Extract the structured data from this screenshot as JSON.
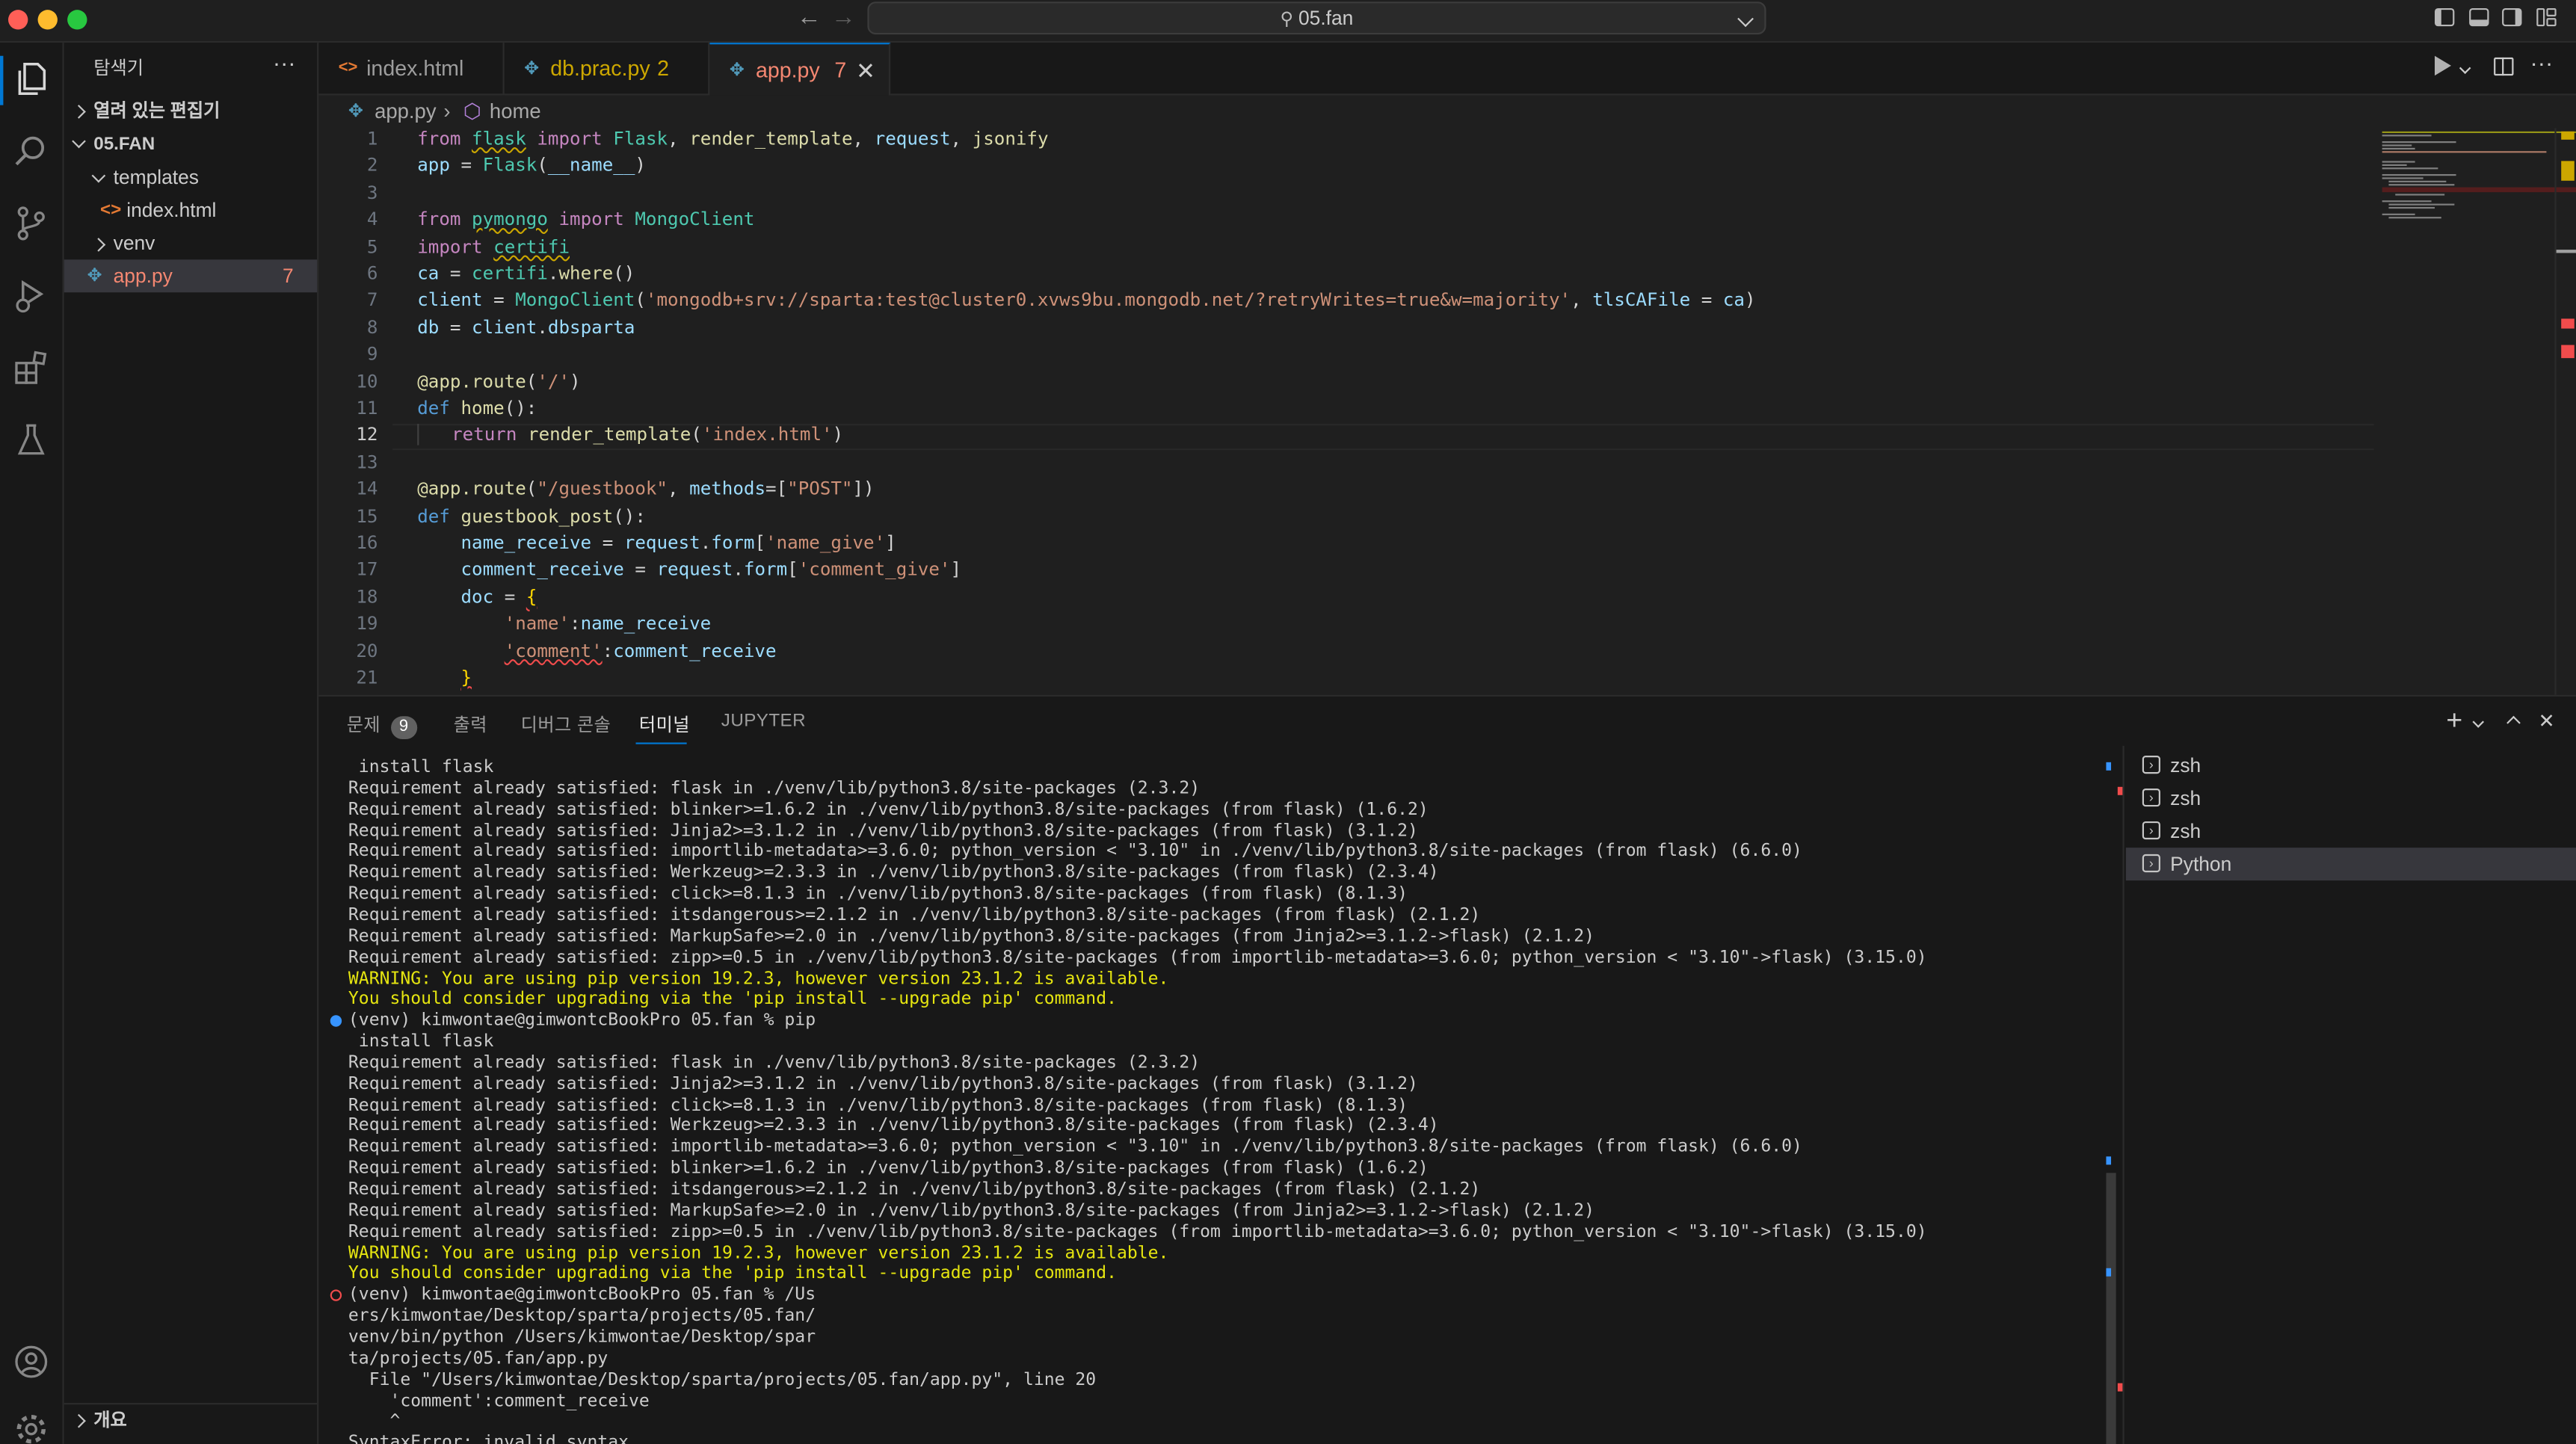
{
  "window": {
    "title": "05.fan"
  },
  "explorer": {
    "title": "탐색기",
    "open_editors": "열려 있는 편집기",
    "project": "05.FAN",
    "items": [
      {
        "label": "templates"
      },
      {
        "label": "index.html"
      },
      {
        "label": "venv"
      },
      {
        "label": "app.py",
        "badge": "7"
      }
    ],
    "outline": "개요"
  },
  "tabs": [
    {
      "label": "index.html",
      "badge": ""
    },
    {
      "label": "db.prac.py",
      "badge": "2"
    },
    {
      "label": "app.py",
      "badge": "7"
    }
  ],
  "breadcrumb": {
    "file": "app.py",
    "symbol": "home"
  },
  "editor": {
    "current_line": 12,
    "line_numbers": [
      "1",
      "2",
      "3",
      "4",
      "5",
      "6",
      "7",
      "8",
      "9",
      "10",
      "11",
      "12",
      "13",
      "14",
      "15",
      "16",
      "17",
      "18",
      "19",
      "20",
      "21"
    ]
  },
  "panel": {
    "tabs": [
      {
        "label": "문제",
        "badge": "9"
      },
      {
        "label": "출력"
      },
      {
        "label": "디버그 콘솔"
      },
      {
        "label": "터미널"
      },
      {
        "label": "JUPYTER"
      }
    ],
    "terminals": [
      "zsh",
      "zsh",
      "zsh",
      "Python"
    ]
  },
  "terminal_lines": [
    {
      "text": " install flask",
      "type": "normal"
    },
    {
      "text": "Requirement already satisfied: flask in ./venv/lib/python3.8/site-packages (2.3.2)",
      "type": "normal"
    },
    {
      "text": "Requirement already satisfied: blinker>=1.6.2 in ./venv/lib/python3.8/site-packages (from flask) (1.6.2)",
      "type": "normal"
    },
    {
      "text": "Requirement already satisfied: Jinja2>=3.1.2 in ./venv/lib/python3.8/site-packages (from flask) (3.1.2)",
      "type": "normal"
    },
    {
      "text": "Requirement already satisfied: importlib-metadata>=3.6.0; python_version < \"3.10\" in ./venv/lib/python3.8/site-packages (from flask) (6.6.0)",
      "type": "normal"
    },
    {
      "text": "Requirement already satisfied: Werkzeug>=2.3.3 in ./venv/lib/python3.8/site-packages (from flask) (2.3.4)",
      "type": "normal"
    },
    {
      "text": "Requirement already satisfied: click>=8.1.3 in ./venv/lib/python3.8/site-packages (from flask) (8.1.3)",
      "type": "normal"
    },
    {
      "text": "Requirement already satisfied: itsdangerous>=2.1.2 in ./venv/lib/python3.8/site-packages (from flask) (2.1.2)",
      "type": "normal"
    },
    {
      "text": "Requirement already satisfied: MarkupSafe>=2.0 in ./venv/lib/python3.8/site-packages (from Jinja2>=3.1.2->flask) (2.1.2)",
      "type": "normal"
    },
    {
      "text": "Requirement already satisfied: zipp>=0.5 in ./venv/lib/python3.8/site-packages (from importlib-metadata>=3.6.0; python_version < \"3.10\"->flask) (3.15.0)",
      "type": "normal"
    },
    {
      "text": "WARNING: You are using pip version 19.2.3, however version 23.1.2 is available.",
      "type": "warn"
    },
    {
      "text": "You should consider upgrading via the 'pip install --upgrade pip' command.",
      "type": "warn"
    },
    {
      "text": "(venv) kimwontae@gimwontcBookPro 05.fan % pip",
      "type": "prompt-ok"
    },
    {
      "text": " install flask",
      "type": "normal"
    },
    {
      "text": "Requirement already satisfied: flask in ./venv/lib/python3.8/site-packages (2.3.2)",
      "type": "normal"
    },
    {
      "text": "Requirement already satisfied: Jinja2>=3.1.2 in ./venv/lib/python3.8/site-packages (from flask) (3.1.2)",
      "type": "normal"
    },
    {
      "text": "Requirement already satisfied: click>=8.1.3 in ./venv/lib/python3.8/site-packages (from flask) (8.1.3)",
      "type": "normal"
    },
    {
      "text": "Requirement already satisfied: Werkzeug>=2.3.3 in ./venv/lib/python3.8/site-packages (from flask) (2.3.4)",
      "type": "normal"
    },
    {
      "text": "Requirement already satisfied: importlib-metadata>=3.6.0; python_version < \"3.10\" in ./venv/lib/python3.8/site-packages (from flask) (6.6.0)",
      "type": "normal"
    },
    {
      "text": "Requirement already satisfied: blinker>=1.6.2 in ./venv/lib/python3.8/site-packages (from flask) (1.6.2)",
      "type": "normal"
    },
    {
      "text": "Requirement already satisfied: itsdangerous>=2.1.2 in ./venv/lib/python3.8/site-packages (from flask) (2.1.2)",
      "type": "normal"
    },
    {
      "text": "Requirement already satisfied: MarkupSafe>=2.0 in ./venv/lib/python3.8/site-packages (from Jinja2>=3.1.2->flask) (2.1.2)",
      "type": "normal"
    },
    {
      "text": "Requirement already satisfied: zipp>=0.5 in ./venv/lib/python3.8/site-packages (from importlib-metadata>=3.6.0; python_version < \"3.10\"->flask) (3.15.0)",
      "type": "normal"
    },
    {
      "text": "WARNING: You are using pip version 19.2.3, however version 23.1.2 is available.",
      "type": "warn"
    },
    {
      "text": "You should consider upgrading via the 'pip install --upgrade pip' command.",
      "type": "warn"
    },
    {
      "text": "(venv) kimwontae@gimwontcBookPro 05.fan % /Us",
      "type": "prompt-err"
    },
    {
      "text": "ers/kimwontae/Desktop/sparta/projects/05.fan/",
      "type": "normal"
    },
    {
      "text": "venv/bin/python /Users/kimwontae/Desktop/spar",
      "type": "normal"
    },
    {
      "text": "ta/projects/05.fan/app.py",
      "type": "normal"
    },
    {
      "text": "  File \"/Users/kimwontae/Desktop/sparta/projects/05.fan/app.py\", line 20",
      "type": "normal"
    },
    {
      "text": "    'comment':comment_receive",
      "type": "normal"
    },
    {
      "text": "    ^",
      "type": "normal"
    },
    {
      "text": "SyntaxError: invalid syntax",
      "type": "normal"
    }
  ],
  "colors": {
    "accent": "#0078d4",
    "error": "#f14c4c",
    "warning": "#e5e510",
    "prompt_ok": "#3794ff"
  }
}
